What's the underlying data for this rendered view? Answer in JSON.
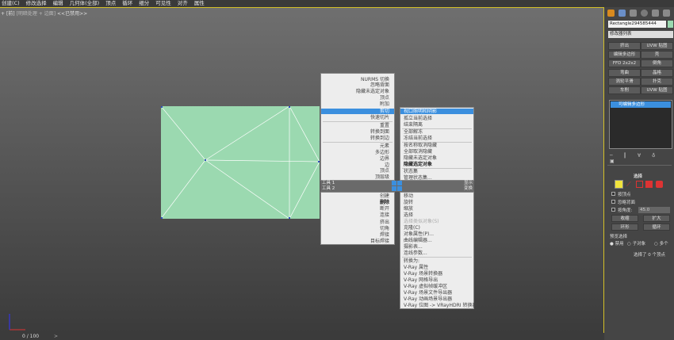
{
  "menubar": [
    "创建(C)",
    "修改选择",
    "编辑",
    "几何体(全部)",
    "顶点",
    "循环",
    "细分",
    "可见性",
    "对齐",
    "属性"
  ],
  "viewport": {
    "label_plus": "+",
    "label_view": "[前]",
    "label_shading": "[明暗处理 + 边面]",
    "label_extra": "<<已禁用>>"
  },
  "status": {
    "text": "0 / 100"
  },
  "quad_left_top": [
    "NURMS 切换",
    "忽略背面",
    "隐藏未选定对象",
    "顶点",
    "附加",
    "剪切",
    "快速切片",
    "重置",
    "转换到面",
    "转换到边",
    "元素",
    "多边形",
    "边界",
    "边",
    "顶点",
    "顶层级"
  ],
  "quad_right_top": [
    "视口照明和阴影",
    "孤立当前选择",
    "结束隔离",
    "全部解冻",
    "冻结当前选择",
    "按名称取消隐藏",
    "全部取消隐藏",
    "隐藏未选定对象",
    "隐藏选定对象",
    "状态集",
    "管理状态集..."
  ],
  "quad_headers": {
    "tools1": "工具 1",
    "tools2": "工具 2",
    "display": "显示",
    "transform": "变换"
  },
  "quad_left_bottom": [
    "创建",
    "删除",
    "断开",
    "连接",
    "挤出",
    "切角",
    "焊接",
    "目标焊接"
  ],
  "quad_right_bottom": [
    "移动",
    "旋转",
    "缩放",
    "选择",
    "选择类似对象(S)",
    "克隆(C)",
    "对象属性(P)...",
    "曲线编辑器...",
    "摄影表...",
    "连线参数...",
    "转换为:",
    "V-Ray 属性",
    "V-Ray 场景转换器",
    "V-Ray 网格导出",
    "V-Ray 虚拟帧缓冲区",
    "V-Ray 场景文件导出器",
    "V-Ray 动画场景导出器",
    "V-Ray 位图 -> VRayHDRI 转换器"
  ],
  "panel": {
    "object_name": "Rectangle294585444",
    "modifier_list": "修改器列表",
    "buttons": [
      "挤出",
      "UVW 贴图",
      "编辑多边形",
      "壳",
      "FFD 2x2x2",
      "倒角",
      "弯曲",
      "晶格",
      "涡轮平滑",
      "扑克",
      "车削",
      "UVW 贴图"
    ],
    "stack_item": "可编辑多边形",
    "selection_title": "选择",
    "by_vertex": "按顶点",
    "ignore_backface": "忽略背面",
    "by_angle": "按角度:",
    "angle_value": "45.0",
    "shrink": "收缩",
    "grow": "扩大",
    "ring": "环形",
    "loop": "循环",
    "preview_title": "预览选择",
    "preview_off": "禁用",
    "preview_subobj": "子对象",
    "preview_multi": "多个",
    "selected_count": "选择了 0 个顶点"
  },
  "colors": {
    "accent": "#3b8fde",
    "object": "#9bd9b0",
    "viewport_border": "#d4c028"
  }
}
